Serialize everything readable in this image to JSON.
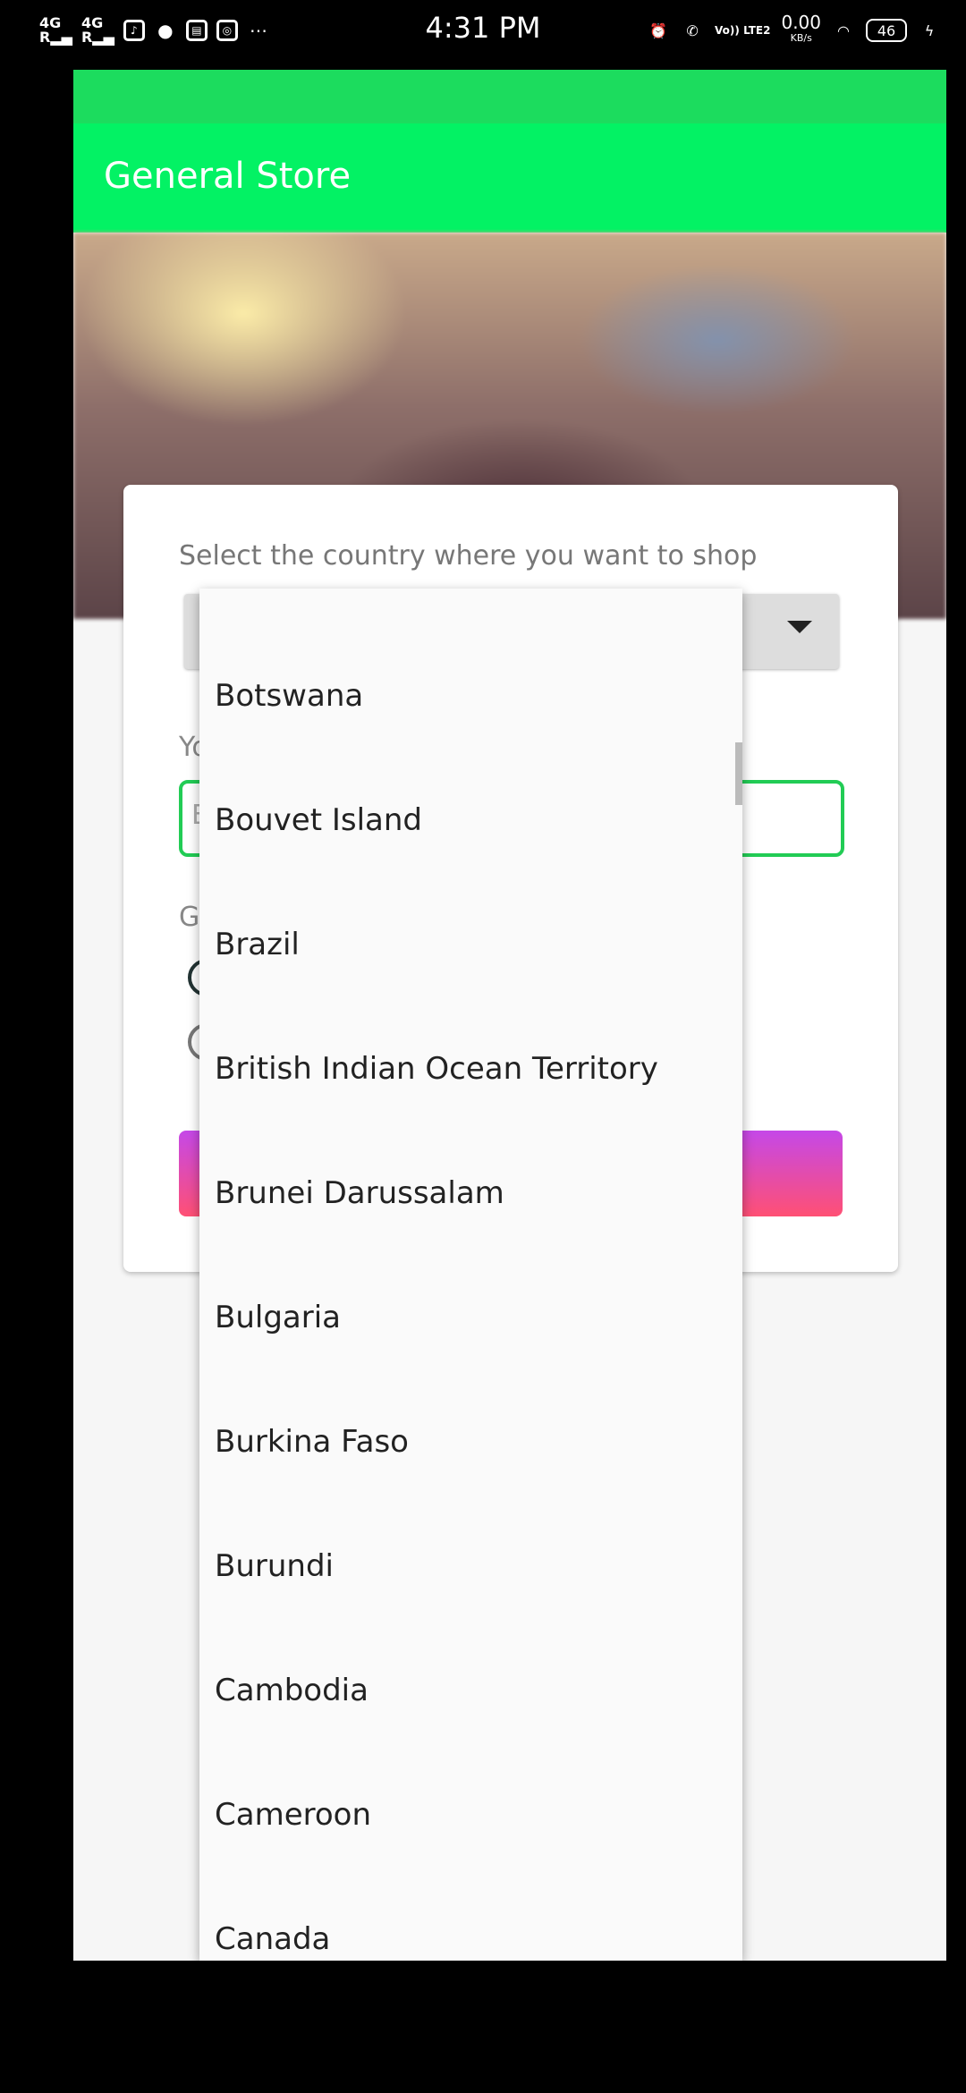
{
  "status_bar": {
    "network1": "4G",
    "network2": "4G",
    "time": "4:31 PM",
    "speed_value": "0.00",
    "speed_unit": "KB/s",
    "volte": "Vo)) LTE2",
    "battery": "46"
  },
  "toolbar": {
    "title": "General Store"
  },
  "form": {
    "country_label": "Select the country where you want to shop",
    "name_label_partial": "Yo",
    "name_placeholder_partial": "E",
    "gender_label_partial": "G"
  },
  "dropdown": {
    "items": [
      "Botswana",
      "Bouvet Island",
      "Brazil",
      "British Indian Ocean Territory",
      "Brunei Darussalam",
      "Bulgaria",
      "Burkina Faso",
      "Burundi",
      "Cambodia",
      "Cameroon",
      "Canada"
    ]
  },
  "colors": {
    "toolbar": "#03f264",
    "app_status_strip": "#1cdc5e",
    "field_border": "#22cc55",
    "button_gradient_top": "#c548e8",
    "button_gradient_bottom": "#ff5074"
  }
}
